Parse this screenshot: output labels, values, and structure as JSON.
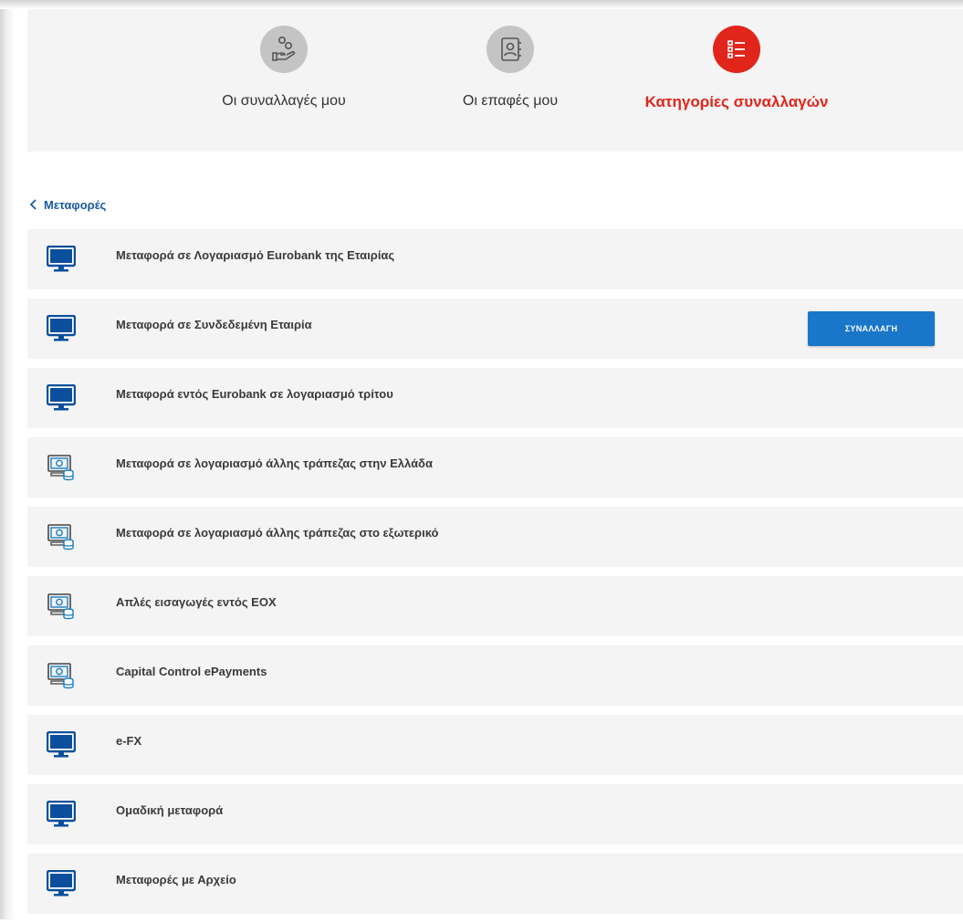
{
  "colors": {
    "accent_red": "#e1251b",
    "link_blue": "#1b5aa0",
    "button_blue": "#1976c8",
    "icon_blue": "#0b4f9c",
    "inactive_icon_bg": "#c4c4c4",
    "panel_bg": "#f4f4f4"
  },
  "tabs": [
    {
      "label": "Οι συναλλαγές μου",
      "icon": "hand-coins-icon",
      "active": false
    },
    {
      "label": "Οι επαφές μου",
      "icon": "address-book-icon",
      "active": false
    },
    {
      "label": "Κατηγορίες συναλλαγών",
      "icon": "list-icon",
      "active": true
    }
  ],
  "breadcrumb": {
    "back_label": "Μεταφορές",
    "icon": "chevron-left-icon"
  },
  "items": [
    {
      "label": "Μεταφορά σε Λογαριασμό Eurobank της Εταιρίας",
      "icon": "monitor-icon"
    },
    {
      "label": "Μεταφορά σε Συνδεδεμένη Εταιρία",
      "icon": "monitor-icon",
      "action": "ΣΥΝΑΛΛΑΓΗ"
    },
    {
      "label": "Μεταφορά εντός Eurobank σε λογαριασμό τρίτου",
      "icon": "monitor-icon"
    },
    {
      "label": "Μεταφορά σε λογαριασμό άλλης τράπεζας στην Ελλάδα",
      "icon": "cash-coins-icon"
    },
    {
      "label": "Μεταφορά σε λογαριασμό άλλης τράπεζας στο εξωτερικό",
      "icon": "cash-coins-icon"
    },
    {
      "label": "Απλές εισαγωγές εντός ΕΟΧ",
      "icon": "cash-coins-icon"
    },
    {
      "label": "Capital Control ePayments",
      "icon": "cash-coins-icon"
    },
    {
      "label": "e-FX",
      "icon": "monitor-icon"
    },
    {
      "label": "Ομαδική μεταφορά",
      "icon": "monitor-icon"
    },
    {
      "label": "Μεταφορές με Αρχείο",
      "icon": "monitor-icon"
    }
  ]
}
